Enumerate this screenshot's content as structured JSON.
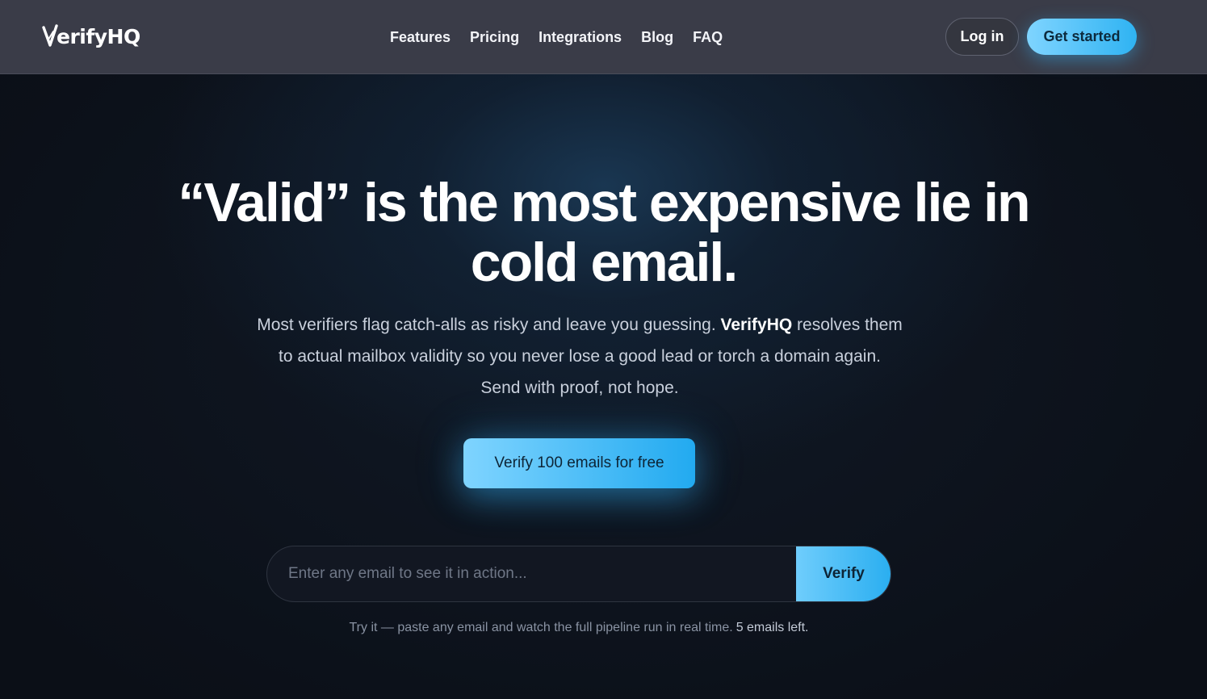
{
  "brand": {
    "name": "VerifyHQ",
    "logo_suffix": "erifyHQ"
  },
  "nav": {
    "links": [
      "Features",
      "Pricing",
      "Integrations",
      "Blog",
      "FAQ"
    ],
    "login_label": "Log in",
    "get_started_label": "Get started"
  },
  "hero": {
    "title": "“Valid” is the most expensive lie in cold email.",
    "subtitle_before": "Most verifiers flag catch-alls as risky and leave you guessing. ",
    "subtitle_brand": "VerifyHQ",
    "subtitle_after": " resolves them to actual mailbox validity so you never lose a good lead or torch a domain again. Send with proof, not hope.",
    "cta_label": "Verify 100 emails for free"
  },
  "demo": {
    "input_value": "",
    "input_placeholder": "Enter any email to see it in action...",
    "verify_label": "Verify",
    "hint_text": "Try it — paste any email and watch the full pipeline run in real time.",
    "emails_left": "5 emails left."
  },
  "colors": {
    "nav_bg": "#3a3c48",
    "page_bg": "#0b0f17",
    "accent_light": "#7fd4ff",
    "accent": "#2fb3f2"
  }
}
